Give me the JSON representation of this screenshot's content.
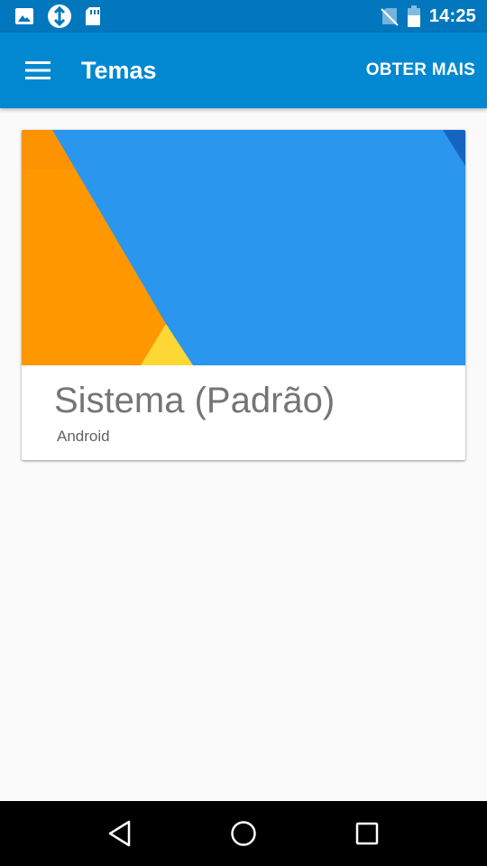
{
  "status_bar": {
    "time": "14:25",
    "left_icons": [
      "image-icon",
      "sync-icon",
      "sd-card-icon"
    ],
    "right_icons": [
      "no-sim-icon",
      "battery-icon"
    ]
  },
  "app_bar": {
    "title": "Temas",
    "action_label": "OBTER MAIS",
    "menu_icon": "menu-icon",
    "background": "#0288d1"
  },
  "themes": [
    {
      "title": "Sistema (Padrão)",
      "subtitle": "Android",
      "colors": {
        "blue": "#2a96ee",
        "orange": "#ff9800",
        "yellow": "#fdd835",
        "dark_blue": "#1565c0"
      }
    }
  ],
  "nav_bar": {
    "buttons": [
      "back-icon",
      "home-icon",
      "recents-icon"
    ]
  }
}
